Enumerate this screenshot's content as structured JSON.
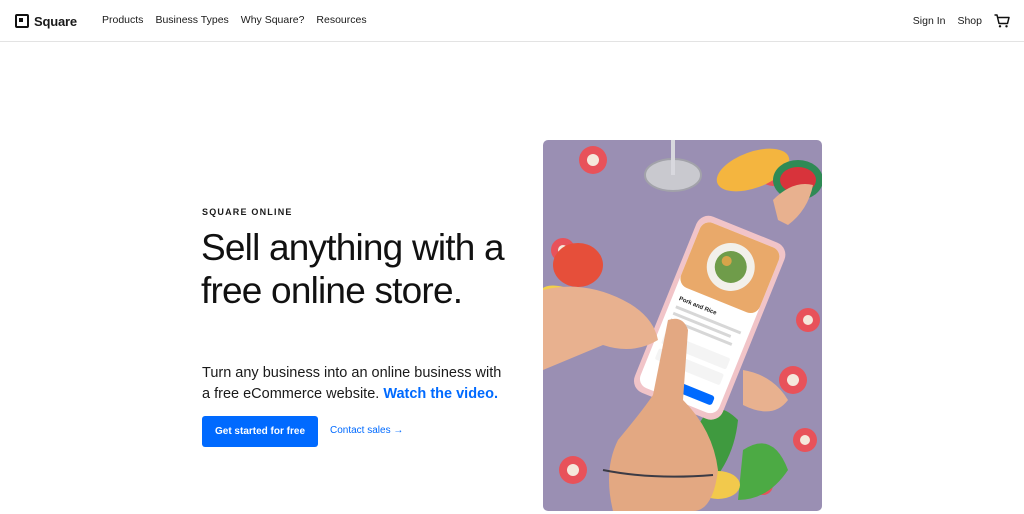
{
  "header": {
    "brand": "Square",
    "nav": [
      "Products",
      "Business Types",
      "Why Square?",
      "Resources"
    ],
    "sign_in": "Sign In",
    "shop": "Shop"
  },
  "hero": {
    "eyebrow": "SQUARE ONLINE",
    "headline": "Sell anything with a free online store.",
    "subcopy": "Turn any business into an online business with a free eCommerce website.",
    "video_link": "Watch the video.",
    "cta_primary": "Get started for free",
    "cta_secondary": "Contact sales →",
    "image": {
      "subject": "hands holding a phone showing an online store listing over a floral tablecloth",
      "phone_item_title": "Pork and Rice"
    }
  },
  "colors": {
    "accent": "#006aff",
    "tablecloth": "#9a8fb3",
    "text": "#1a1a1a"
  }
}
